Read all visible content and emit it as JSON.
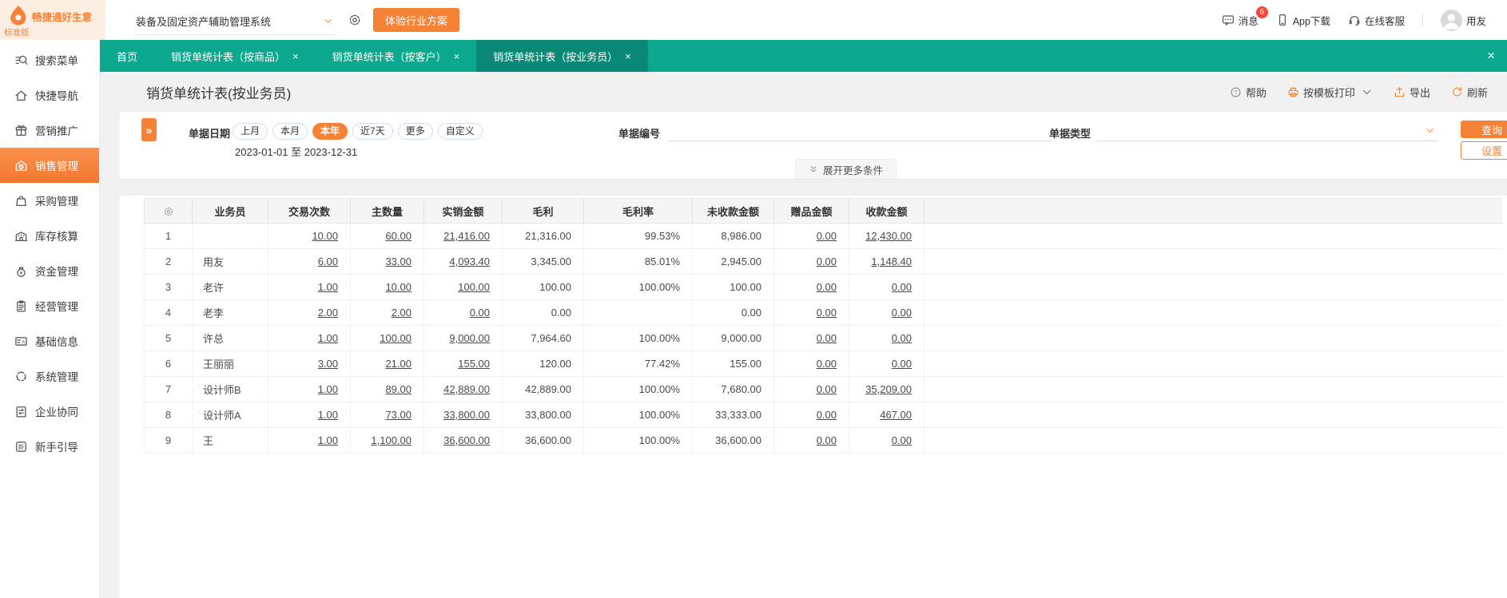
{
  "colors": {
    "teal": "#0ca98e",
    "teal_dark": "#0a8a76",
    "orange": "#f58235",
    "orange_light": "#fcefe2",
    "badge_red": "#f2473a"
  },
  "topbar": {
    "brand": {
      "title": "畅捷通好生意",
      "edition": "标准版"
    },
    "system_dropdown": {
      "value": "装备及固定资产辅助管理系统"
    },
    "trial_button": "体验行业方案",
    "messages": {
      "label": "消息",
      "badge": "6"
    },
    "app_download": "App下载",
    "online_service": "在线客服",
    "username": "用友"
  },
  "tabbar": {
    "tabs": [
      {
        "label": "首页",
        "active": false,
        "closable": false
      },
      {
        "label": "销货单统计表（按商品）",
        "active": false,
        "closable": true
      },
      {
        "label": "销货单统计表（按客户）",
        "active": false,
        "closable": true
      },
      {
        "label": "销货单统计表（按业务员）",
        "active": true,
        "closable": true
      }
    ]
  },
  "sidebar": {
    "items": [
      {
        "label": "搜索菜单",
        "icon": "search-menu",
        "active": false
      },
      {
        "label": "快捷导航",
        "icon": "quick-nav-home",
        "active": false
      },
      {
        "label": "营销推广",
        "icon": "marketing-gift",
        "active": false
      },
      {
        "label": "销售管理",
        "icon": "sales-house",
        "active": true
      },
      {
        "label": "采购管理",
        "icon": "purchase-bag",
        "active": false
      },
      {
        "label": "库存核算",
        "icon": "inventory-warehouse",
        "active": false
      },
      {
        "label": "资金管理",
        "icon": "funds-moneybag",
        "active": false
      },
      {
        "label": "经营管理",
        "icon": "operation-clipboard",
        "active": false
      },
      {
        "label": "基础信息",
        "icon": "basicinfo-card",
        "active": false
      },
      {
        "label": "系统管理",
        "icon": "system-dots",
        "active": false
      },
      {
        "label": "企业协同",
        "icon": "collab-board",
        "active": false
      },
      {
        "label": "新手引导",
        "icon": "guide-new",
        "active": false
      }
    ]
  },
  "page": {
    "title": "销货单统计表(按业务员)",
    "toolbar": {
      "help": "帮助",
      "print": "按模板打印",
      "export": "导出",
      "refresh": "刷新"
    }
  },
  "filters": {
    "date_label": "单据日期",
    "date_pills": [
      {
        "label": "上月",
        "active": false
      },
      {
        "label": "本月",
        "active": false
      },
      {
        "label": "本年",
        "active": true
      },
      {
        "label": "近7天",
        "active": false
      },
      {
        "label": "更多",
        "active": false
      },
      {
        "label": "自定义",
        "active": false
      }
    ],
    "date_range": "2023-01-01 至 2023-12-31",
    "doc_no_label": "单据编号",
    "doc_type_label": "单据类型",
    "query_button": "查询",
    "settings_button": "设置",
    "expand_more": "展开更多条件"
  },
  "table": {
    "columns": [
      "业务员",
      "交易次数",
      "主数量",
      "实销金额",
      "毛利",
      "毛利率",
      "未收款金额",
      "赠品金额",
      "收款金额"
    ],
    "link_columns": [
      0,
      1,
      2,
      6,
      7
    ],
    "rows": [
      {
        "n": "1",
        "name": "",
        "cells": [
          "10.00",
          "60.00",
          "21,416.00",
          "21,316.00",
          "99.53%",
          "8,986.00",
          "0.00",
          "12,430.00"
        ]
      },
      {
        "n": "2",
        "name": "用友",
        "cells": [
          "6.00",
          "33.00",
          "4,093.40",
          "3,345.00",
          "85.01%",
          "2,945.00",
          "0.00",
          "1,148.40"
        ]
      },
      {
        "n": "3",
        "name": "老许",
        "cells": [
          "1.00",
          "10.00",
          "100.00",
          "100.00",
          "100.00%",
          "100.00",
          "0.00",
          "0.00"
        ]
      },
      {
        "n": "4",
        "name": "老李",
        "cells": [
          "2.00",
          "2.00",
          "0.00",
          "0.00",
          "",
          "0.00",
          "0.00",
          "0.00"
        ]
      },
      {
        "n": "5",
        "name": "许总",
        "cells": [
          "1.00",
          "100.00",
          "9,000.00",
          "7,964.60",
          "100.00%",
          "9,000.00",
          "0.00",
          "0.00"
        ]
      },
      {
        "n": "6",
        "name": "王丽丽",
        "cells": [
          "3.00",
          "21.00",
          "155.00",
          "120.00",
          "77.42%",
          "155.00",
          "0.00",
          "0.00"
        ]
      },
      {
        "n": "7",
        "name": "设计师B",
        "cells": [
          "1.00",
          "89.00",
          "42,889.00",
          "42,889.00",
          "100.00%",
          "7,680.00",
          "0.00",
          "35,209.00"
        ]
      },
      {
        "n": "8",
        "name": "设计师A",
        "cells": [
          "1.00",
          "73.00",
          "33,800.00",
          "33,800.00",
          "100.00%",
          "33,333.00",
          "0.00",
          "467.00"
        ]
      },
      {
        "n": "9",
        "name": "王",
        "cells": [
          "1.00",
          "1,100.00",
          "36,600.00",
          "36,600.00",
          "100.00%",
          "36,600.00",
          "0.00",
          "0.00"
        ]
      }
    ]
  }
}
